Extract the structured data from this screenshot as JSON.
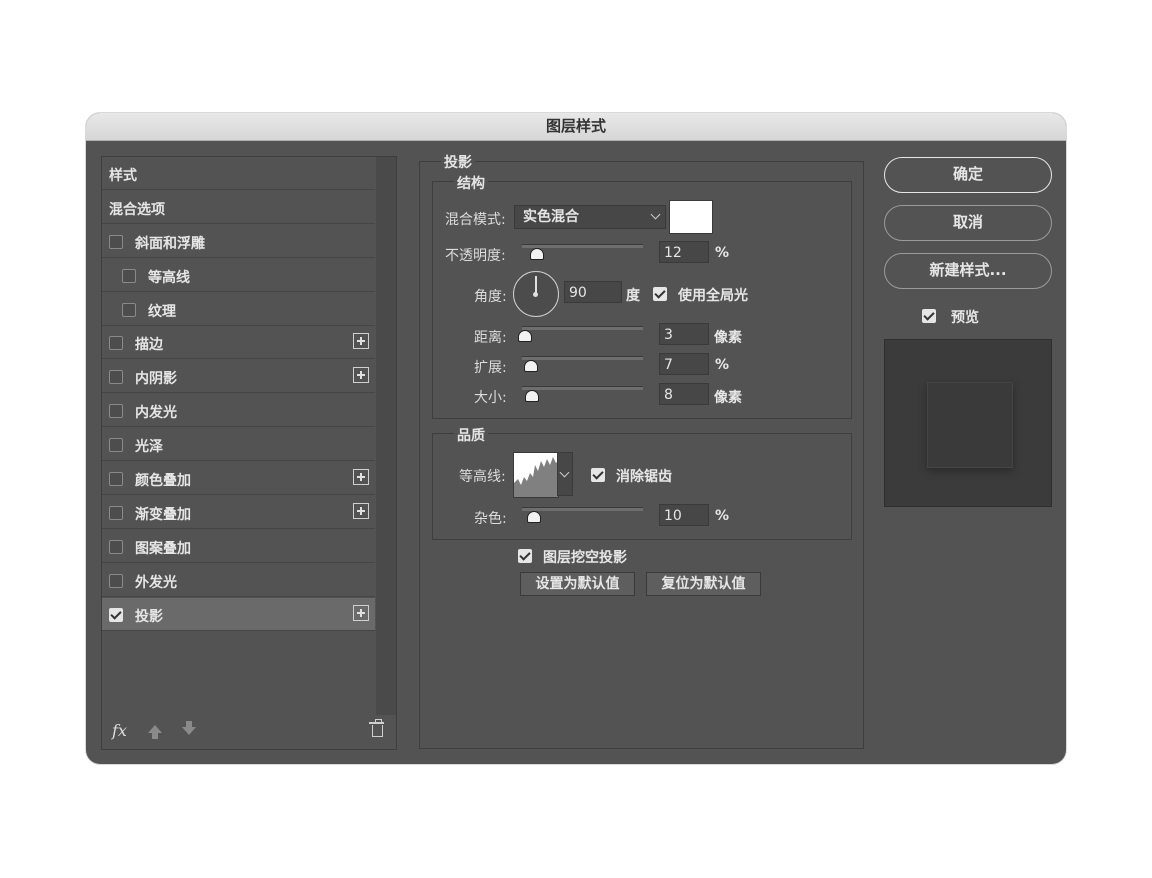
{
  "dialog": {
    "title": "图层样式"
  },
  "styles_list": {
    "items": [
      {
        "label": "样式",
        "checkbox": false,
        "checked": false,
        "plus": false
      },
      {
        "label": "混合选项",
        "checkbox": false,
        "checked": false,
        "plus": false
      },
      {
        "label": "斜面和浮雕",
        "checkbox": true,
        "checked": false,
        "plus": false
      },
      {
        "label": "等高线",
        "checkbox": true,
        "checked": false,
        "plus": false,
        "indent": true
      },
      {
        "label": "纹理",
        "checkbox": true,
        "checked": false,
        "plus": false,
        "indent": true
      },
      {
        "label": "描边",
        "checkbox": true,
        "checked": false,
        "plus": true
      },
      {
        "label": "内阴影",
        "checkbox": true,
        "checked": false,
        "plus": true
      },
      {
        "label": "内发光",
        "checkbox": true,
        "checked": false,
        "plus": false
      },
      {
        "label": "光泽",
        "checkbox": true,
        "checked": false,
        "plus": false
      },
      {
        "label": "颜色叠加",
        "checkbox": true,
        "checked": false,
        "plus": true
      },
      {
        "label": "渐变叠加",
        "checkbox": true,
        "checked": false,
        "plus": true
      },
      {
        "label": "图案叠加",
        "checkbox": true,
        "checked": false,
        "plus": false
      },
      {
        "label": "外发光",
        "checkbox": true,
        "checked": false,
        "plus": false
      },
      {
        "label": "投影",
        "checkbox": true,
        "checked": true,
        "plus": true,
        "active": true
      }
    ],
    "footer": {
      "fx_label": "fx"
    }
  },
  "drop_shadow": {
    "section_title": "投影",
    "structure": {
      "title": "结构",
      "blend_mode_label": "混合模式:",
      "blend_mode_value": "实色混合",
      "shadow_color": "#ffffff",
      "opacity_label": "不透明度:",
      "opacity_value": "12",
      "opacity_unit": "%",
      "angle_label": "角度:",
      "angle_value": "90",
      "angle_unit": "度",
      "global_light_label": "使用全局光",
      "global_light_checked": true,
      "distance_label": "距离:",
      "distance_value": "3",
      "distance_unit": "像素",
      "spread_label": "扩展:",
      "spread_value": "7",
      "spread_unit": "%",
      "size_label": "大小:",
      "size_value": "8",
      "size_unit": "像素"
    },
    "quality": {
      "title": "品质",
      "contour_label": "等高线:",
      "anti_alias_label": "消除锯齿",
      "anti_alias_checked": true,
      "noise_label": "杂色:",
      "noise_value": "10",
      "noise_unit": "%"
    },
    "knockout_label": "图层挖空投影",
    "knockout_checked": true,
    "make_default_label": "设置为默认值",
    "reset_default_label": "复位为默认值"
  },
  "actions": {
    "ok_label": "确定",
    "cancel_label": "取消",
    "new_style_label": "新建样式...",
    "preview_label": "预览",
    "preview_checked": true
  }
}
